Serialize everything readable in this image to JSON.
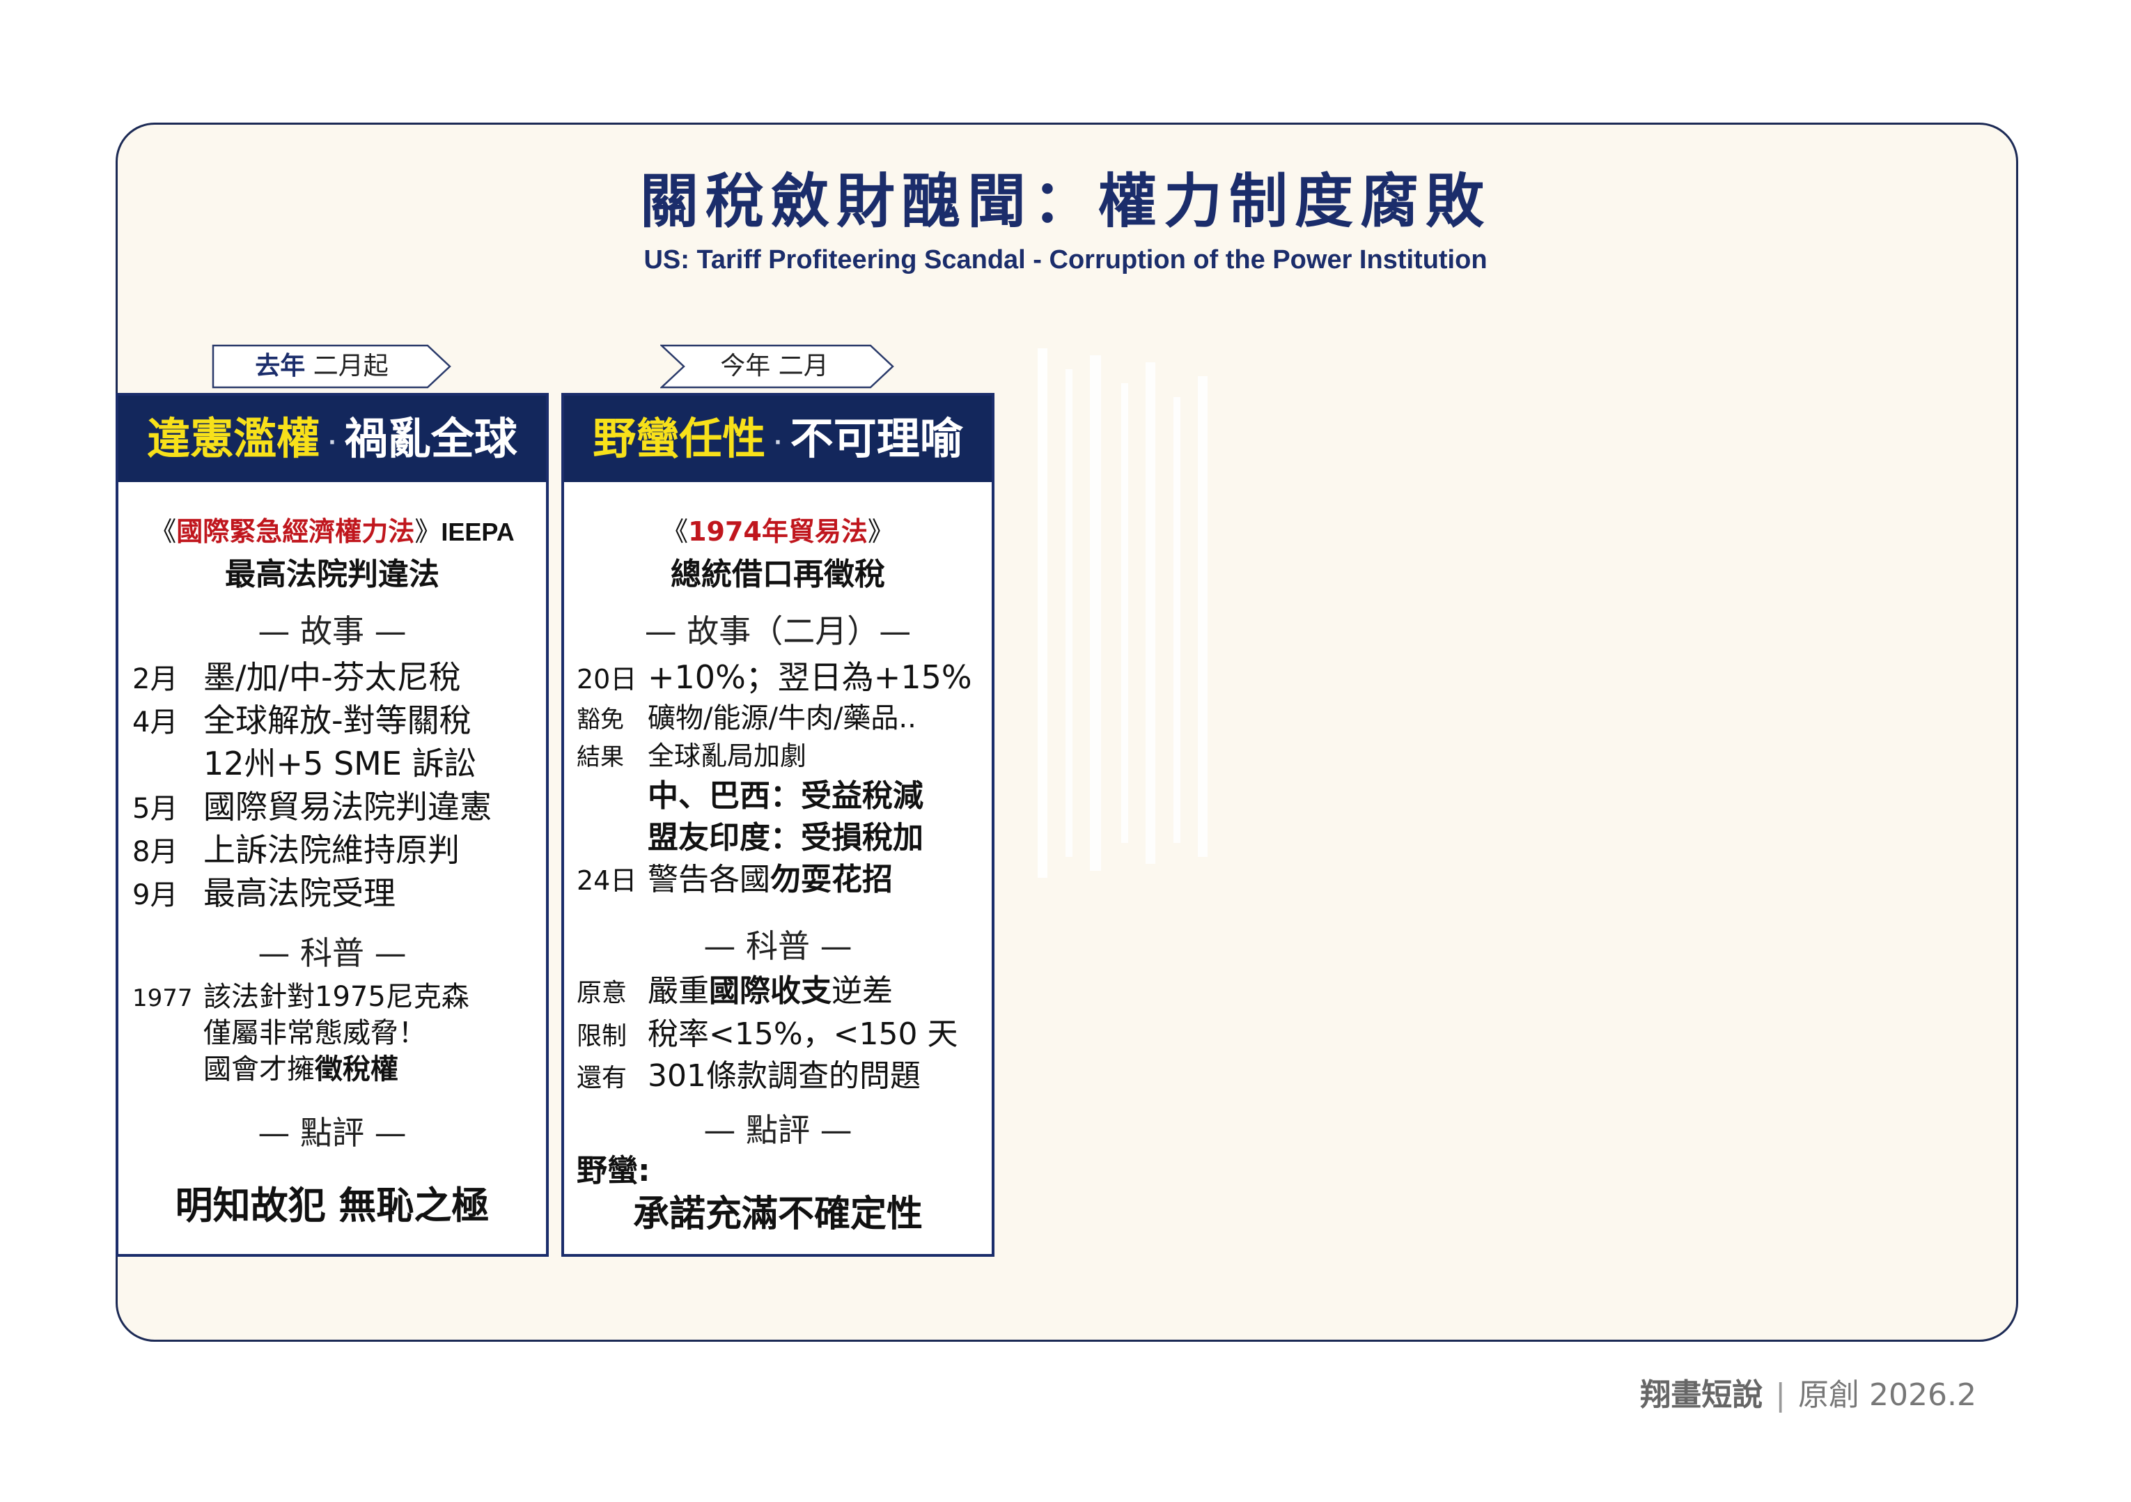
{
  "title": "關稅斂財醜聞：權力制度腐敗",
  "subtitle": "US: Tariff Profiteering Scandal - Corruption of the Power Institution",
  "tabs": [
    {
      "accent": "去年",
      "rest": " 二月起"
    },
    {
      "accent": "今年",
      "rest": " 二月"
    }
  ],
  "cards": [
    {
      "head_yellow": "違憲濫權",
      "head_dot": "·",
      "head_white": "禍亂全球",
      "law_open": "《",
      "law_name": "國際緊急經濟權力法",
      "law_close": "》",
      "law_suffix": "IEEPA",
      "law_verdict": "最高法院判違法",
      "story_heading": "— 故事 —",
      "story": [
        {
          "label": "2月",
          "text": "墨/加/中-芬太尼稅"
        },
        {
          "label": "4月",
          "text": "全球解放-對等關稅"
        },
        {
          "label": "",
          "text": "12州+5 SME 訴訟"
        },
        {
          "label": "5月",
          "text": "國際貿易法院判違憲"
        },
        {
          "label": "8月",
          "text": "上訴法院維持原判"
        },
        {
          "label": "9月",
          "text": "最高法院受理"
        }
      ],
      "science_heading": "— 科普 —",
      "science": [
        {
          "label": "1977",
          "text": "該法針對1975尼克森"
        },
        {
          "label": "",
          "text": "僅屬非常態威脅！"
        },
        {
          "label": "",
          "text": "國會才擁",
          "bold": "徵稅權"
        }
      ],
      "review_heading": "— 點評 —",
      "review": "明知故犯 無恥之極"
    },
    {
      "head_yellow": "野蠻任性",
      "head_dot": "·",
      "head_white": "不可理喻",
      "law_open": "《",
      "law_name": "1974年貿易法",
      "law_close": "》",
      "law_verdict": "總統借口再徵稅",
      "story_heading": "— 故事（二月）—",
      "story_1_label": "20日",
      "story_1_text": "+10%；翌日為+15%",
      "story_2_label": "豁免",
      "story_2_text": "礦物/能源/牛肉/藥品..",
      "story_3_label": "結果",
      "story_3_text": "全球亂局加劇",
      "story_4": "中、巴西：受益稅減",
      "story_5": "盟友印度：受損稅加",
      "story_6_label": "24日",
      "story_6_pre": "警告各國",
      "story_6_bold": "勿耍花招",
      "science_heading": "— 科普 —",
      "sci_1_label": "原意",
      "sci_1_pre": "嚴重",
      "sci_1_bold": "國際收支",
      "sci_1_post": "逆差",
      "sci_2_label": "限制",
      "sci_2_text": "稅率<15%，<150 天",
      "sci_3_label": "還有",
      "sci_3_text": "301條款調查的問題",
      "review_heading": "— 點評 —",
      "review_label": "野蠻:",
      "review": "承諾充滿不確定性"
    }
  ],
  "footer": {
    "brand": "翔畫短說",
    "sep": "|",
    "note": "原創 2026.2"
  },
  "colors": {
    "navy": "#13275c",
    "title_blue": "#1b2d6b",
    "highlight_yellow": "#f8e11a",
    "law_red": "#c0161d",
    "frame_bg": "#fcf8ef"
  }
}
